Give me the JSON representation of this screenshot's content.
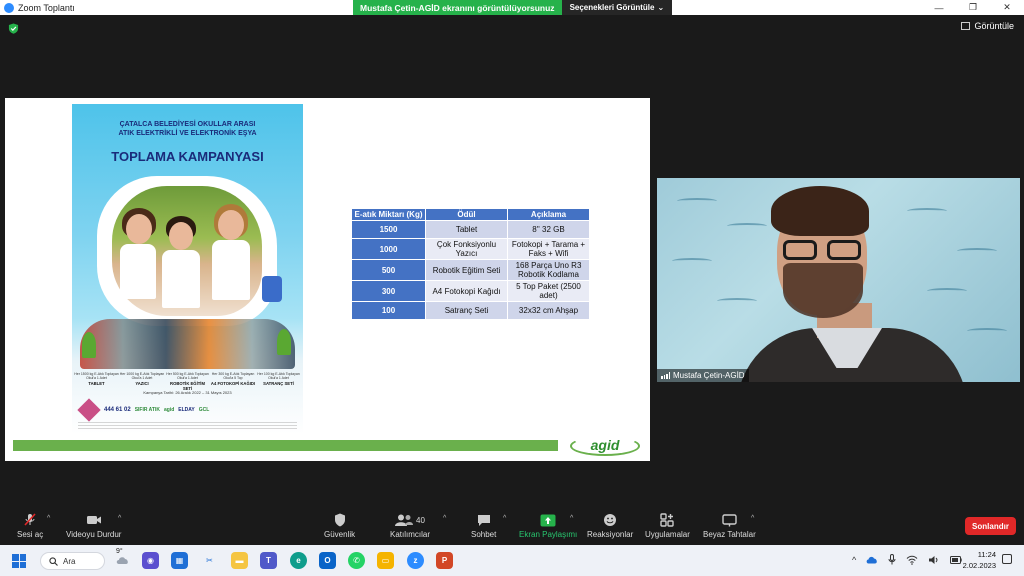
{
  "window": {
    "title": "Zoom Toplantı",
    "share_banner": "Mustafa Çetin-AGİD ekranını görüntülüyorsunuz",
    "view_options": "Seçenekleri Görüntüle",
    "view_options_caret": "⌄",
    "minimize": "—",
    "maximize": "❐",
    "close": "✕"
  },
  "header": {
    "view_label": "Görüntüle"
  },
  "poster": {
    "title_line1": "ÇATALCA BELEDİYESİ OKULLAR ARASI",
    "title_line2": "ATIK ELEKTRİKLİ VE ELEKTRONİK EŞYA",
    "title_big": "TOPLAMA KAMPANYASI",
    "prizes": [
      {
        "desc": "Her 1500 kg E-Atık Toplayan Okul'a 1 Adet",
        "name": "TABLET"
      },
      {
        "desc": "Her 1000 kg E-Atık Toplayan Okul'a 1 Adet",
        "name": "YAZICI"
      },
      {
        "desc": "Her 500 kg E-Atık Toplayan Okul'a 1 Adet",
        "name": "ROBOTİK EĞİTİM SETİ"
      },
      {
        "desc": "Her 300 kg E-Atık Toplayan Okul'a 5 Top",
        "name": "A4 FOTOKOPİ KAĞIDI"
      },
      {
        "desc": "Her 100 kg E-Atık Toplayan Okul'a 1 Adet",
        "name": "SATRANÇ SETİ"
      }
    ],
    "dates": "Kampanya Tarihi: 26 Aralık 2022 – 31 Mayıs 2023",
    "phone": "444 61 02",
    "sponsors": [
      "SIFIR ATIK",
      "agid",
      "ELDAY",
      "GCL"
    ]
  },
  "table": {
    "headers": [
      "E-atık Miktarı (Kg)",
      "Ödül",
      "Açıklama"
    ],
    "rows": [
      {
        "kg": "1500",
        "award": "Tablet",
        "desc": "8'' 32 GB"
      },
      {
        "kg": "1000",
        "award": "Çok Fonksiyonlu Yazıcı",
        "desc": "Fotokopi + Tarama + Faks + Wifi"
      },
      {
        "kg": "500",
        "award": "Robotik Eğitim Seti",
        "desc": "168 Parça Uno R3 Robotik Kodlama"
      },
      {
        "kg": "300",
        "award": "A4 Fotokopi Kağıdı",
        "desc": "5 Top Paket (2500 adet)"
      },
      {
        "kg": "100",
        "award": "Satranç Seti",
        "desc": "32x32 cm Ahşap"
      }
    ]
  },
  "slide_logo": "agid",
  "participant": {
    "name": "Mustafa Çetin-AGİD"
  },
  "toolbar": {
    "mute": "Sesi aç",
    "video": "Videoyu Durdur",
    "security": "Güvenlik",
    "participants": "Katılımcılar",
    "participants_count": "40",
    "chat": "Sohbet",
    "share": "Ekran Paylaşımı",
    "reactions": "Reaksiyonlar",
    "apps": "Uygulamalar",
    "whiteboard": "Beyaz Tahtalar",
    "end": "Sonlandır",
    "caret": "^"
  },
  "taskbar": {
    "search": "Ara",
    "weather": "9°",
    "time": "11:24",
    "date": "2.02.2023",
    "tray_expand": "^"
  },
  "colors": {
    "accent_green": "#26b24b",
    "end_red": "#e02828",
    "table_blue": "#4472c4"
  }
}
